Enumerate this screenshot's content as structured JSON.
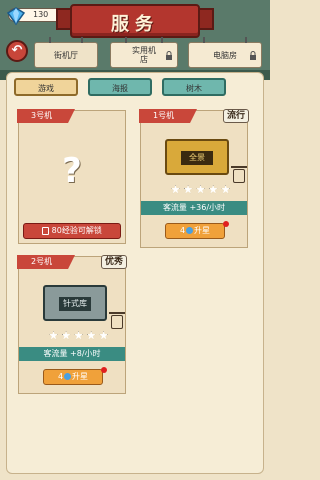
{
  "header": {
    "title": "服务",
    "gems": "130",
    "plus": "+"
  },
  "back": {
    "icon": "back-arrow-icon"
  },
  "places": [
    {
      "label": "街机厅",
      "locked": false
    },
    {
      "label": "实用机\n店",
      "locked": true
    },
    {
      "label": "电脑房",
      "locked": true
    }
  ],
  "categories": [
    {
      "label": "游戏",
      "active": true
    },
    {
      "label": "海报",
      "active": false
    },
    {
      "label": "树木",
      "active": false
    }
  ],
  "cards": [
    {
      "tag": "3号机",
      "locked_text": "80经验可解锁",
      "question": "?"
    },
    {
      "tag": "1号机",
      "badge": "流行",
      "machine_label": "全景",
      "stars": 5,
      "flow": "客流量 +36/小时",
      "upgrade_cost": "4",
      "upgrade_label": "升星"
    },
    {
      "tag": "2号机",
      "badge": "优秀",
      "machine_label": "针式库",
      "stars": 5,
      "flow": "客流量 +8/小时",
      "upgrade_cost": "4",
      "upgrade_label": "升星"
    }
  ],
  "colors": {
    "accent_red": "#c9473a",
    "teal": "#3a8c82",
    "orange": "#f0a13a"
  }
}
